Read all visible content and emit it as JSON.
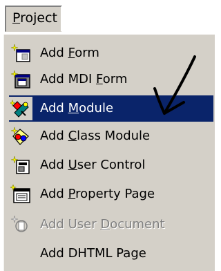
{
  "menubar": {
    "title_pre": "",
    "title_underline": "P",
    "title_rest": "roject"
  },
  "menu": {
    "items": [
      {
        "pre": "Add ",
        "key": "F",
        "rest": "orm",
        "icon": "form-icon",
        "state": "normal"
      },
      {
        "pre": "Add MDI ",
        "key": "F",
        "rest": "orm",
        "icon": "mdi-form-icon",
        "state": "normal"
      },
      {
        "pre": "Add ",
        "key": "M",
        "rest": "odule",
        "icon": "module-icon",
        "state": "selected"
      },
      {
        "pre": "Add ",
        "key": "C",
        "rest": "lass Module",
        "icon": "class-module-icon",
        "state": "normal"
      },
      {
        "pre": "Add ",
        "key": "U",
        "rest": "ser Control",
        "icon": "user-control-icon",
        "state": "normal"
      },
      {
        "pre": "Add ",
        "key": "P",
        "rest": "roperty Page",
        "icon": "property-page-icon",
        "state": "normal"
      },
      {
        "pre": "Add User ",
        "key": "D",
        "rest": "ocument",
        "icon": "user-document-icon",
        "state": "disabled"
      },
      {
        "pre": "Add DHTML Page",
        "key": "",
        "rest": "",
        "icon": "",
        "state": "normal"
      }
    ]
  },
  "colors": {
    "menu_bg": "#d4d0c8",
    "highlight": "#0a246a",
    "disabled_text": "#808080"
  }
}
